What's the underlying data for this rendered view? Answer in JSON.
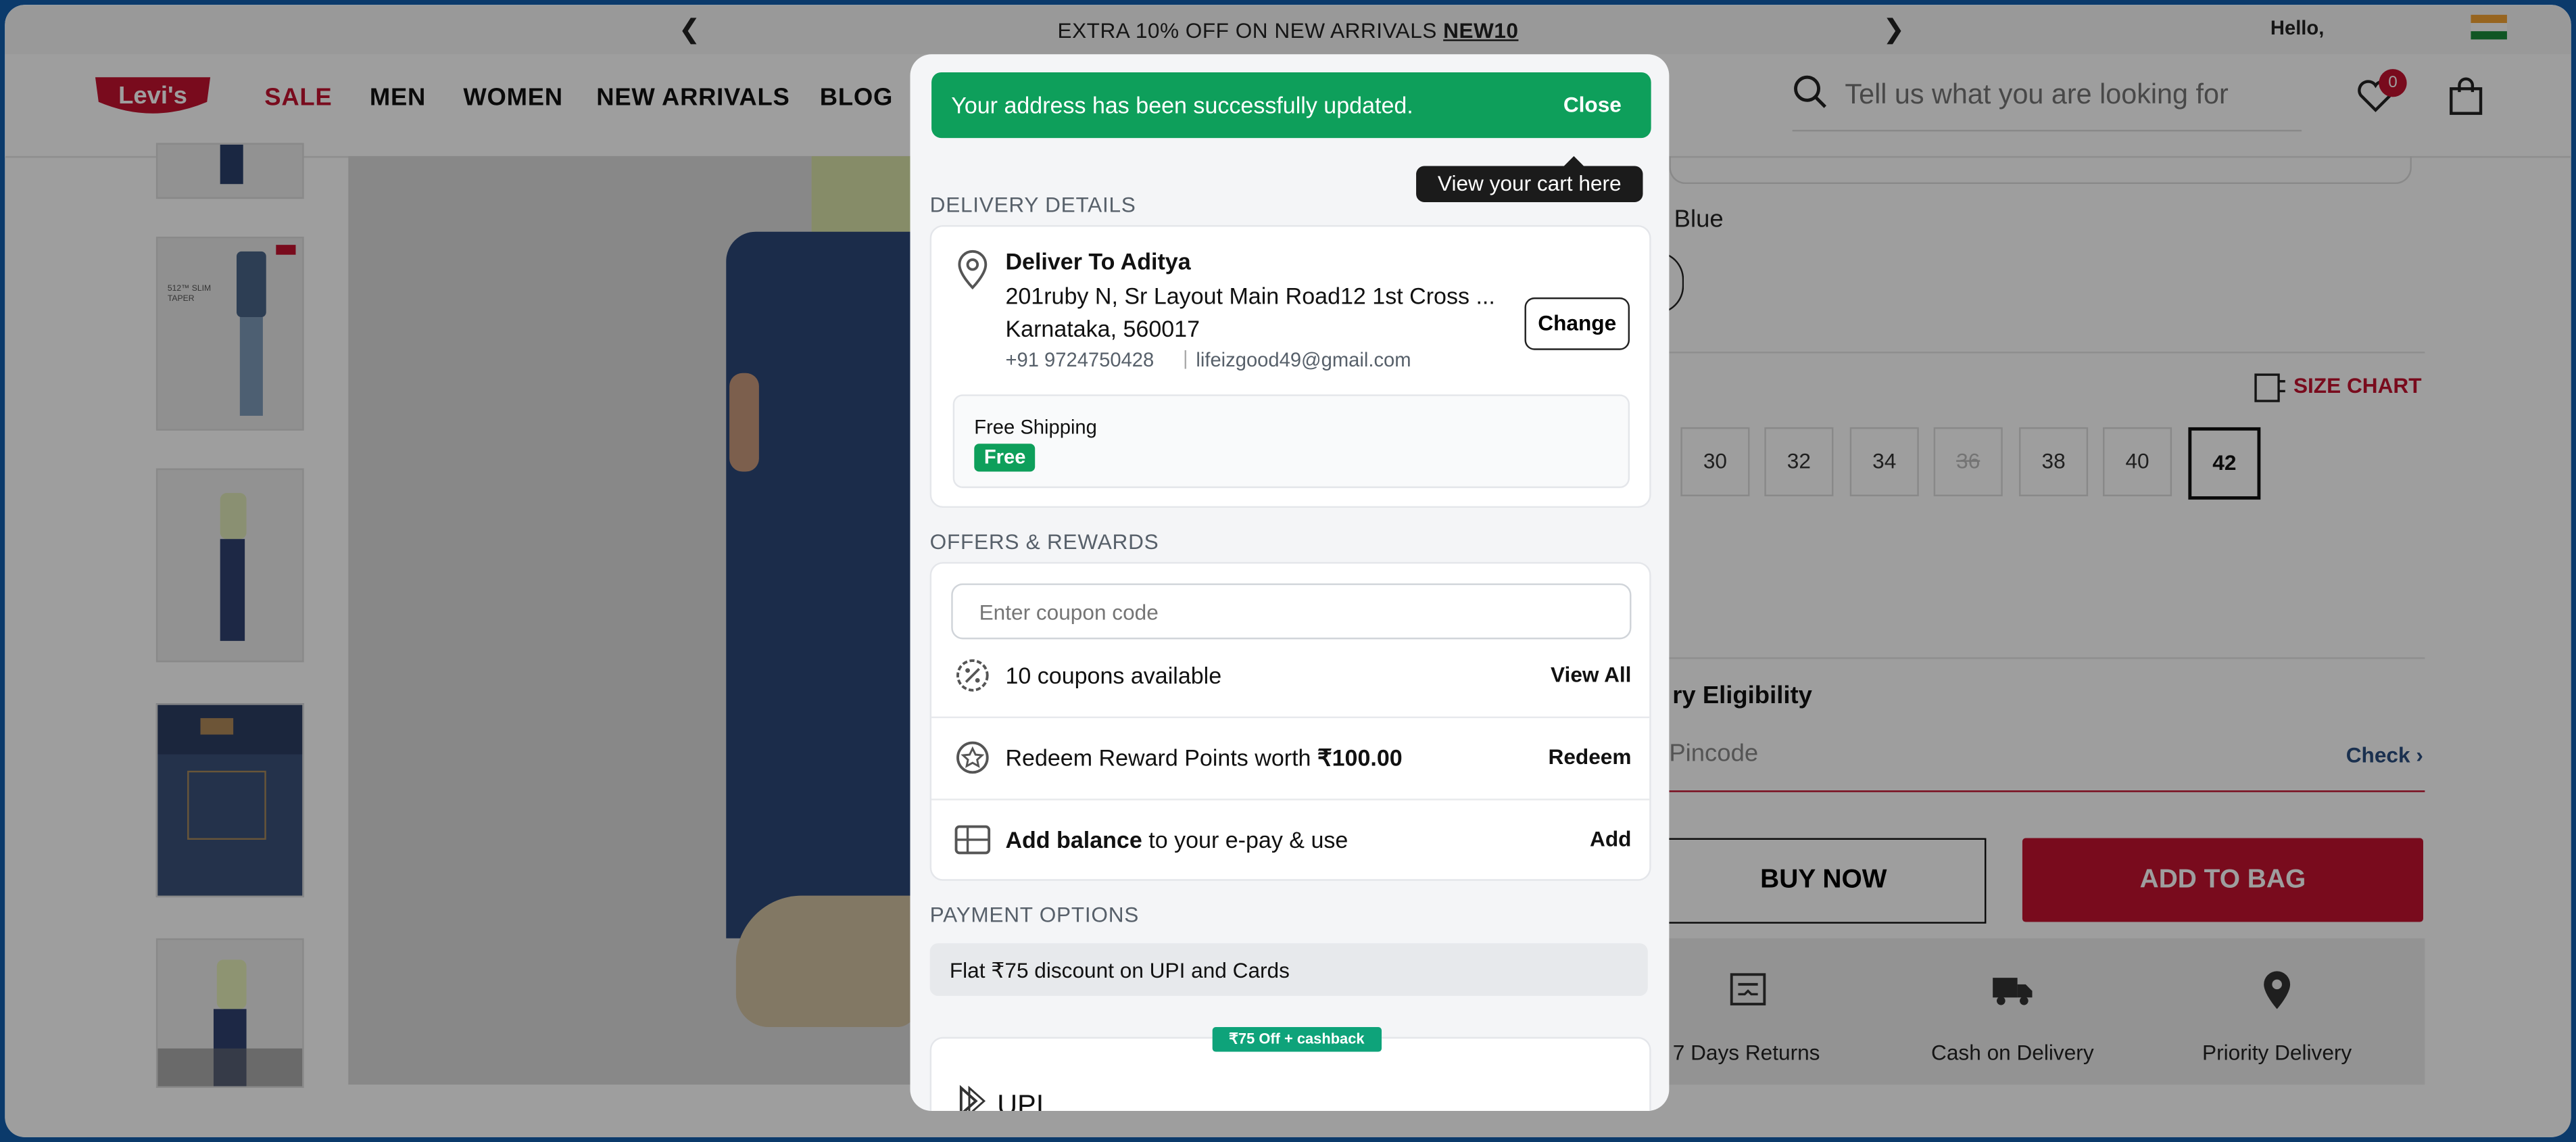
{
  "promo": {
    "text": "EXTRA 10% OFF ON NEW ARRIVALS ",
    "code": "NEW10",
    "hello": "Hello,"
  },
  "brand": {
    "logo": "Levi's",
    "accent": "#c41230",
    "success": "#0e9f5b"
  },
  "nav": {
    "sale": "SALE",
    "men": "MEN",
    "women": "WOMEN",
    "new_arrivals": "NEW ARRIVALS",
    "blog": "BLOG"
  },
  "search": {
    "placeholder": "Tell us what you are looking for"
  },
  "wishlist": {
    "count": "0"
  },
  "thumb_text": {
    "title": "512™ SLIM TAPER"
  },
  "product": {
    "color_label": "Blue",
    "size_chart": "SIZE CHART",
    "sizes": [
      "30",
      "32",
      "34",
      "36",
      "38",
      "40",
      "42"
    ],
    "eligibility": "ry Eligibility",
    "pincode": "Pincode",
    "check": "Check ›",
    "buy_now": "BUY NOW",
    "add_to_bag": "ADD TO BAG",
    "features": [
      "7 Days Returns",
      "Cash on Delivery",
      "Priority Delivery"
    ]
  },
  "modal": {
    "toast": {
      "message": "Your address has been successfully updated.",
      "close": "Close"
    },
    "tooltip": "View your cart here",
    "delivery": {
      "heading": "DELIVERY DETAILS",
      "name": "Deliver To Aditya",
      "line1": "201ruby N, Sr Layout Main Road12 1st Cross ...",
      "line2": "Karnataka, 560017",
      "phone": "+91 9724750428",
      "email": "lifeizgood49@gmail.com",
      "change": "Change",
      "shipping_label": "Free Shipping",
      "shipping_value": "Free"
    },
    "offers": {
      "heading": "OFFERS & REWARDS",
      "coupon_placeholder": "Enter coupon code",
      "coupons_available": "10 coupons available",
      "view_all": "View All",
      "redeem_text": "Redeem Reward Points worth ",
      "redeem_amount": "₹100.00",
      "redeem": "Redeem",
      "balance_bold": "Add balance",
      "balance_text": " to your e-pay & use",
      "add": "Add"
    },
    "payment": {
      "heading": "PAYMENT OPTIONS",
      "banner": "Flat ₹75 discount on UPI and Cards",
      "cashback": "₹75 Off + cashback",
      "upi": "UPI"
    }
  }
}
